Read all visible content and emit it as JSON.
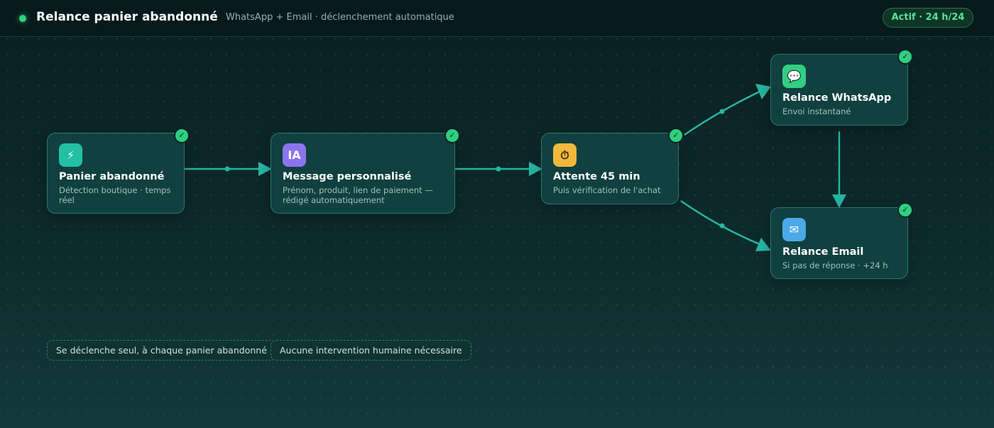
{
  "header": {
    "title": "Relance panier abandonné",
    "subtitle": "WhatsApp + Email · déclenchement automatique",
    "status_badge": "Actif · 24 h/24"
  },
  "nodes": {
    "panier": {
      "icon": "lightning-icon",
      "glyph": "⚡",
      "title": "Panier abandonné",
      "description": "Détection boutique · temps réel",
      "check": "✓"
    },
    "message": {
      "icon": "ia-icon",
      "glyph": "IA",
      "title": "Message personnalisé",
      "description": "Prénom, produit, lien de paiement — rédigé automatiquement",
      "check": "✓"
    },
    "attente": {
      "icon": "timer-icon",
      "glyph": "⏱",
      "title": "Attente 45 min",
      "description": "Puis vérification de l'achat",
      "check": "✓"
    },
    "whatsapp": {
      "icon": "chat-icon",
      "glyph": "💬",
      "title": "Relance WhatsApp",
      "description": "Envoi instantané",
      "check": "✓"
    },
    "email": {
      "icon": "mail-icon",
      "glyph": "✉",
      "title": "Relance Email",
      "description": "Si pas de réponse · +24 h",
      "check": "✓"
    }
  },
  "tags": [
    "Se déclenche seul, à chaque panier abandonné",
    "Aucune intervention humaine nécessaire"
  ],
  "colors": {
    "accent": "#27b5a0",
    "success": "#2fcf80",
    "status_dot": "#36d07e",
    "node_bg": "#10403f"
  }
}
